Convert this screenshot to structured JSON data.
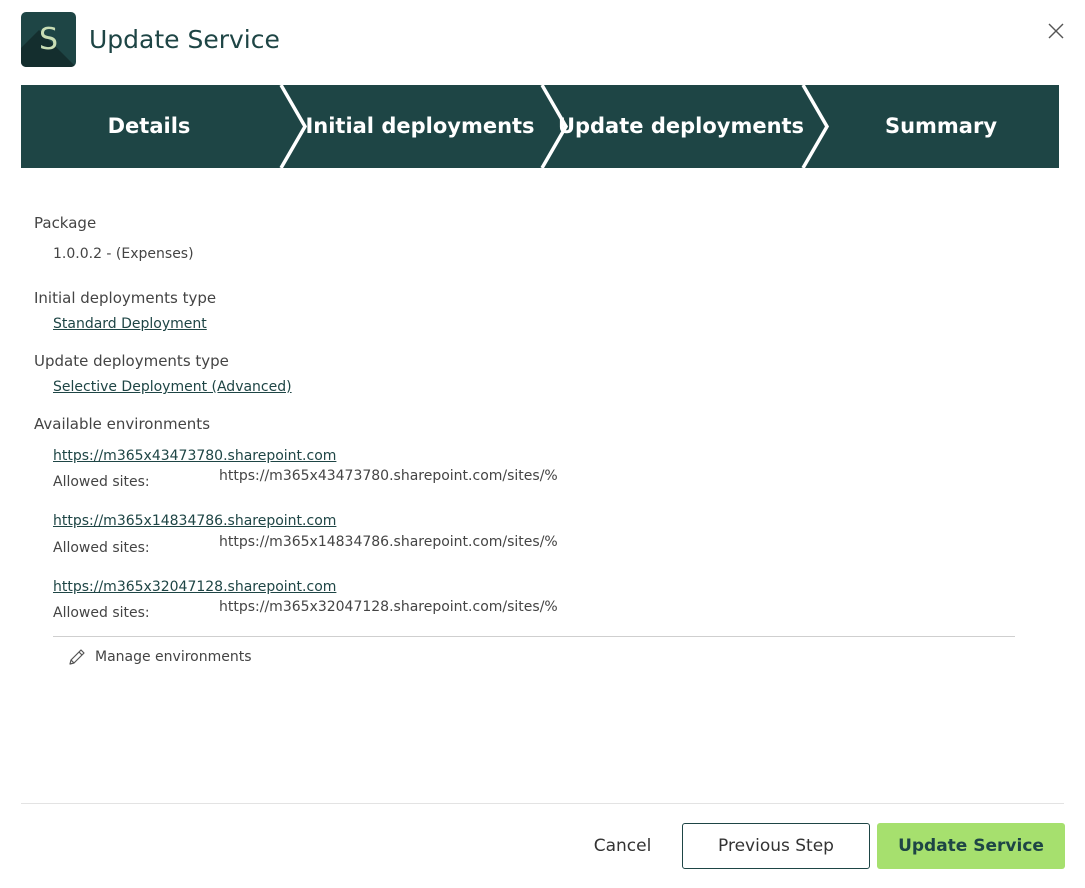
{
  "header": {
    "logo_letter": "S",
    "title": "Update Service",
    "logo_color": "#1e4545",
    "logo_letter_color": "#c8ddb4"
  },
  "stepper": {
    "color": "#1e4545",
    "steps": [
      {
        "label": "Details"
      },
      {
        "label": "Initial deployments"
      },
      {
        "label": "Update deployments"
      },
      {
        "label": "Summary"
      }
    ]
  },
  "details": {
    "package_label": "Package",
    "package_value": "1.0.0.2 - (Expenses)",
    "initial_type_label": "Initial deployments type",
    "initial_type_value": "Standard Deployment",
    "update_type_label": "Update deployments type",
    "update_type_value": "Selective Deployment (Advanced)",
    "environments_label": "Available environments",
    "environments": [
      {
        "url": "https://m365x43473780.sharepoint.com",
        "allowed_label": "Allowed sites:",
        "allowed_sites": "https://m365x43473780.sharepoint.com/sites/%"
      },
      {
        "url": "https://m365x14834786.sharepoint.com",
        "allowed_label": "Allowed sites:",
        "allowed_sites": "https://m365x14834786.sharepoint.com/sites/%"
      },
      {
        "url": "https://m365x32047128.sharepoint.com",
        "allowed_label": "Allowed sites:",
        "allowed_sites": "https://m365x32047128.sharepoint.com/sites/%"
      }
    ],
    "manage_label": "Manage environments"
  },
  "footer": {
    "cancel_label": "Cancel",
    "previous_label": "Previous Step",
    "update_label": "Update Service",
    "accent_color": "#a6e06e"
  }
}
